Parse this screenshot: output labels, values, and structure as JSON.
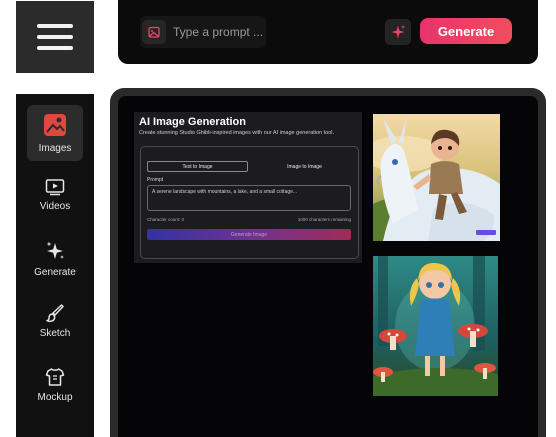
{
  "topbar": {
    "prompt_placeholder": "Type a prompt ...",
    "generate_label": "Generate",
    "accent_color": "#ef4366"
  },
  "sidebar": {
    "items": [
      {
        "label": "Images",
        "icon": "image-icon",
        "active": true
      },
      {
        "label": "Videos",
        "icon": "video-icon",
        "active": false
      },
      {
        "label": "Generate",
        "icon": "sparkle-icon",
        "active": false
      },
      {
        "label": "Sketch",
        "icon": "brush-icon",
        "active": false
      },
      {
        "label": "Mockup",
        "icon": "shirt-icon",
        "active": false
      }
    ]
  },
  "preview": {
    "title": "AI Image Generation",
    "subtitle": "Create stunning Studio Ghibli-inspired images with our AI image generation tool.",
    "tab_text_to_image": "Text to Image",
    "tab_image_to_image": "Image to Image",
    "prompt_label": "Prompt",
    "prompt_value": "A serene landscape with mountains, a lake, and a small cottage...",
    "char_count": "Character count: 0",
    "chars_remaining": "1000 characters remaining",
    "generate_label": "Generate Image"
  },
  "gallery": [
    {
      "name": "child-riding-white-dragon"
    },
    {
      "name": "girl-in-blue-dress-mushroom-forest"
    }
  ]
}
